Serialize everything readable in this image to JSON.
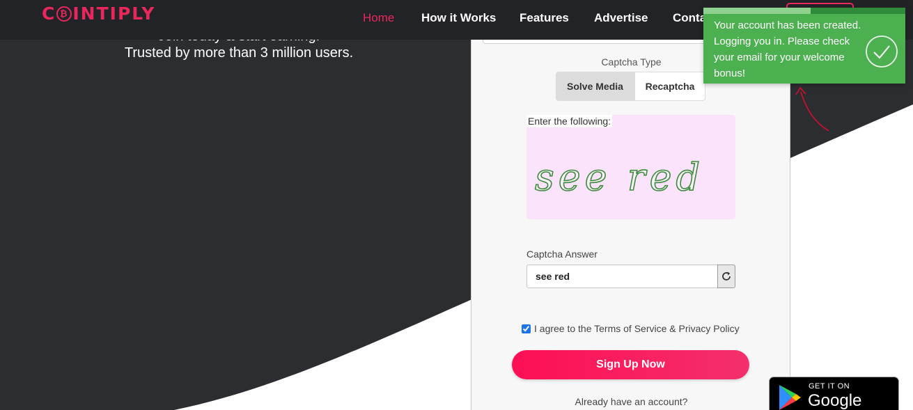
{
  "app": {
    "logo_text": "C₿INTIPLY",
    "logo_left": "C",
    "logo_coin": "₿",
    "logo_right": "INTIPLY"
  },
  "nav": {
    "items": [
      {
        "label": "Home",
        "active": true
      },
      {
        "label": "How it Works"
      },
      {
        "label": "Features"
      },
      {
        "label": "Advertise"
      },
      {
        "label": "Conta"
      }
    ]
  },
  "hero": {
    "line1": "Join today & start earning.",
    "line2": "Trusted by more than 3 million users."
  },
  "form": {
    "captcha_type_label": "Captcha Type",
    "tabs": [
      {
        "label": "Solve Media",
        "selected": true
      },
      {
        "label": "Recaptcha",
        "selected": false
      }
    ],
    "captcha_instruction": "Enter the following:",
    "captcha_text": "see red",
    "answer_label": "Captcha Answer",
    "answer_value": "see red",
    "refresh_icon": "refresh-icon",
    "agree_text": "I agree to the Terms of Service & Privacy Policy",
    "agree_checked": true,
    "signup_label": "Sign Up Now",
    "login_prompt": "Already have an account?"
  },
  "toast": {
    "message": "Your account has been created. Logging you in. Please check your email for your welcome bonus!",
    "progress": 0.53,
    "icon": "check-circle-icon"
  },
  "google_play": {
    "small": "GET IT ON",
    "big": "Google Play"
  },
  "colors": {
    "brand": "#e8285c",
    "nav_bg": "#222327",
    "hero_bg": "#2b2d31",
    "toast_bg": "#4caf50",
    "signup_gradient_start": "#fd0f54",
    "signup_gradient_end": "#f42f6c"
  }
}
